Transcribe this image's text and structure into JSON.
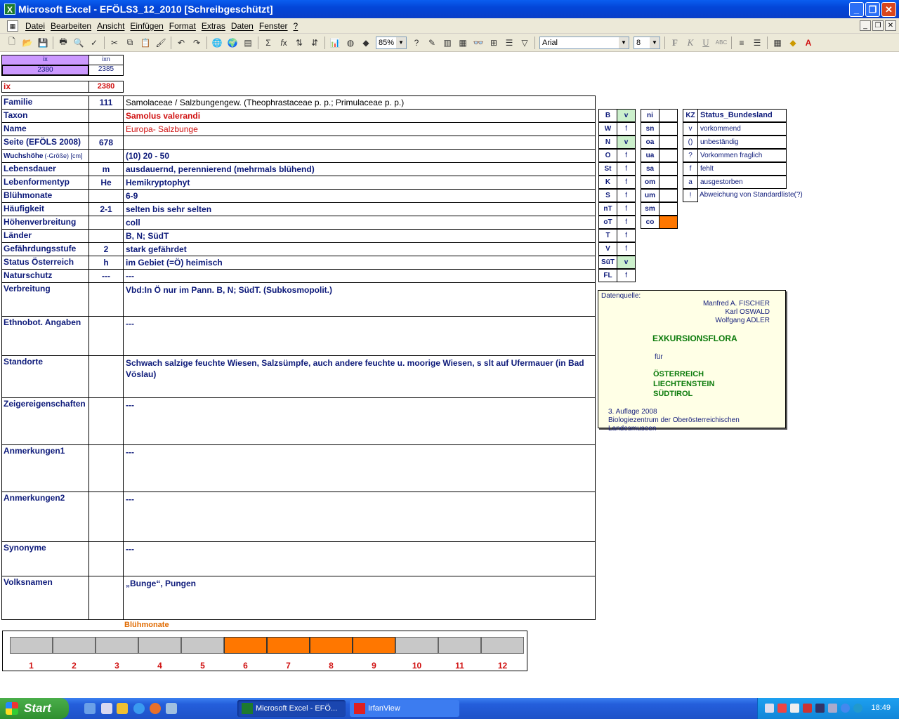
{
  "window": {
    "title": "Microsoft Excel - EFÖLS3_12_2010  [Schreibgeschützt]"
  },
  "menu": [
    "Datei",
    "Bearbeiten",
    "Ansicht",
    "Einfügen",
    "Format",
    "Extras",
    "Daten",
    "Fenster",
    "?"
  ],
  "toolbar": {
    "zoom": "85%",
    "font": "Arial",
    "size": "8"
  },
  "index": {
    "ix_header": "ix",
    "ixn_header": "ixn",
    "ix_value": "2380",
    "ixn_value": "2385",
    "ix_label": "ix",
    "ix_repeat": "2380"
  },
  "rows": [
    {
      "label": "Familie",
      "num": "111",
      "value": "Samolaceae  /  Salzbungengew. (Theophrastaceae p. p.; Primulaceae p. p.)"
    },
    {
      "label": "Taxon",
      "num": "",
      "value": "Samolus valerandi"
    },
    {
      "label": "Name",
      "num": "",
      "value": "Europa- Salzbunge"
    },
    {
      "label": "Seite (EFÖLS 2008)",
      "num": "678",
      "value": ""
    },
    {
      "label": "Wuchshöhe",
      "label_suffix": "(-Größe) [cm]",
      "num": "",
      "value": "(10) 20 - 50"
    },
    {
      "label": "Lebensdauer",
      "num": "m",
      "value": "ausdauernd, perennierend (mehrmals blühend)"
    },
    {
      "label": "Lebenformentyp",
      "num": "He",
      "value": "Hemikryptophyt"
    },
    {
      "label": "Blühmonate",
      "num": "",
      "value": "6-9"
    },
    {
      "label": "Häufigkeit",
      "num": "2-1",
      "value": "selten bis sehr selten"
    },
    {
      "label": "Höhenverbreitung",
      "num": "",
      "value": "coll"
    },
    {
      "label": "Länder",
      "num": "",
      "value": "B, N; SüdT"
    },
    {
      "label": "Gefährdungsstufe",
      "num": "2",
      "value": "stark gefährdet"
    },
    {
      "label": "Status Österreich",
      "num": "h",
      "value": "im Gebiet (=Ö) heimisch"
    },
    {
      "label": "Naturschutz",
      "num": "---",
      "value": "---"
    }
  ],
  "blocks": [
    {
      "label": "Verbreitung",
      "value": "Vbd:In Ö nur im Pann. B, N; SüdT. (Subkosmopolit.)"
    },
    {
      "label": "Ethnobot. Angaben",
      "value": "---"
    },
    {
      "label": "Standorte",
      "value": "Schwach salzige feuchte Wiesen, Salzsümpfe, auch andere feuchte u. moorige Wiesen, s slt auf Ufermauer (in Bad Vöslau)"
    },
    {
      "label": "Zeigereigenschaften",
      "value": "---"
    },
    {
      "label": "Anmerkungen1",
      "value": "---"
    },
    {
      "label": "Anmerkungen2",
      "value": "---"
    },
    {
      "label": "Synonyme",
      "value": "---"
    },
    {
      "label": "Volksnamen",
      "value": "„Bunge“, Pungen"
    }
  ],
  "states": [
    {
      "code": "B",
      "val": "v"
    },
    {
      "code": "W",
      "val": "f"
    },
    {
      "code": "N",
      "val": "v"
    },
    {
      "code": "O",
      "val": "f"
    },
    {
      "code": "St",
      "val": "f"
    },
    {
      "code": "K",
      "val": "f"
    },
    {
      "code": "S",
      "val": "f"
    },
    {
      "code": "nT",
      "val": "f"
    },
    {
      "code": "oT",
      "val": "f"
    },
    {
      "code": "T",
      "val": "f"
    },
    {
      "code": "V",
      "val": "f"
    },
    {
      "code": "SüT",
      "val": "v"
    },
    {
      "code": "FL",
      "val": "f"
    }
  ],
  "altitudes": [
    {
      "code": "ni",
      "val": ""
    },
    {
      "code": "sn",
      "val": ""
    },
    {
      "code": "oa",
      "val": ""
    },
    {
      "code": "ua",
      "val": ""
    },
    {
      "code": "sa",
      "val": ""
    },
    {
      "code": "om",
      "val": ""
    },
    {
      "code": "um",
      "val": ""
    },
    {
      "code": "sm",
      "val": ""
    },
    {
      "code": "co",
      "val": ""
    }
  ],
  "legend": {
    "header_kz": "KZ",
    "header_title": "Status_Bundesland",
    "items": [
      {
        "kz": "v",
        "text": "vorkommend"
      },
      {
        "kz": "()",
        "text": "unbeständig"
      },
      {
        "kz": "?",
        "text": "Vorkommen fraglich"
      },
      {
        "kz": "f",
        "text": "fehlt"
      },
      {
        "kz": "a",
        "text": "ausgestorben"
      },
      {
        "kz": "!",
        "text": "Abweichung von Standardliste(?)"
      }
    ]
  },
  "source": {
    "label": "Datenquelle:",
    "authors": [
      "Manfred A. FISCHER",
      "Karl OSWALD",
      "Wolfgang ADLER"
    ],
    "title": "EXKURSIONSFLORA",
    "fuer": "für",
    "countries": [
      "ÖSTERREICH",
      "LIECHTENSTEIN",
      "SÜDTIROL"
    ],
    "edition": "3. Auflage 2008",
    "publisher": "Biologiezentrum der Oberösterreichischen Landesmuseen"
  },
  "months": {
    "title": "Blühmonate",
    "labels": [
      "1",
      "2",
      "3",
      "4",
      "5",
      "6",
      "7",
      "8",
      "9",
      "10",
      "11",
      "12"
    ],
    "active": [
      6,
      7,
      8,
      9
    ]
  },
  "taskbar": {
    "start": "Start",
    "tasks": [
      "Microsoft Excel - EFÖ...",
      "IrfanView"
    ],
    "clock": "18:49"
  },
  "colors": {
    "accent_orange": "#ff7700",
    "active_green": "#ccf0cc",
    "index_purple": "#cc99ff",
    "label_blue": "#0d1a7a",
    "red": "#d01010"
  }
}
